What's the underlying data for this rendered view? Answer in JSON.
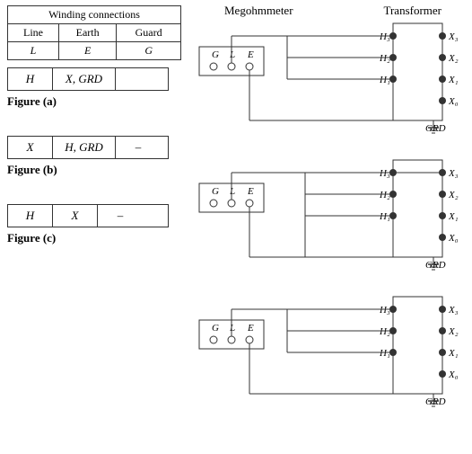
{
  "winding": {
    "title": "Winding connections",
    "headers": [
      "Line",
      "Earth",
      "Guard"
    ],
    "values": [
      "L",
      "E",
      "G"
    ]
  },
  "figures": [
    {
      "id": "a",
      "label": "Figure (a)",
      "conn": [
        {
          "val": "H"
        },
        {
          "val": "X, GRD"
        },
        {
          "val": ""
        }
      ]
    },
    {
      "id": "b",
      "label": "Figure (b)",
      "conn": [
        {
          "val": "X"
        },
        {
          "val": "H, GRD"
        },
        {
          "val": "–"
        }
      ]
    },
    {
      "id": "c",
      "label": "Figure (c)",
      "conn": [
        {
          "val": "H"
        },
        {
          "val": "X"
        },
        {
          "val": "–"
        }
      ]
    }
  ],
  "headers": {
    "megohmmeter": "Megohmmeter",
    "transformer": "Transformer"
  },
  "terminals": {
    "h": [
      "H₃",
      "H₂",
      "H₁"
    ],
    "x": [
      "X₃",
      "X₂",
      "X₁",
      "X₀"
    ],
    "grd": "GRD",
    "meg_labels": [
      "G",
      "L",
      "E"
    ]
  }
}
